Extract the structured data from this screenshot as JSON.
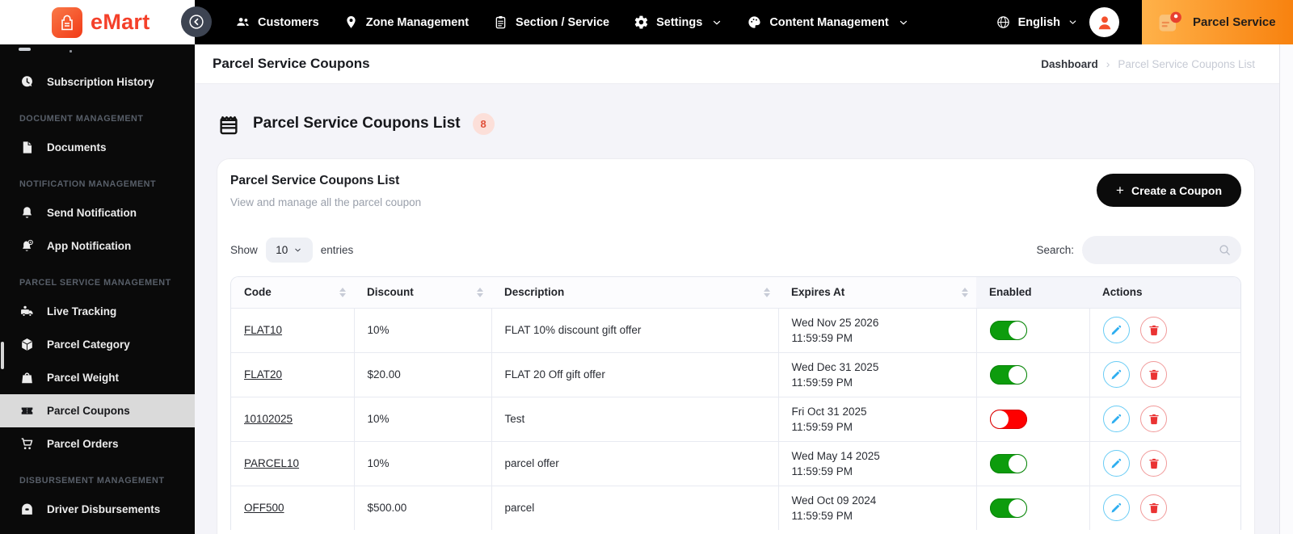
{
  "navbar": {
    "brand": "eMart",
    "menu": [
      {
        "label": "Customers",
        "icon": "customers-icon",
        "caret": false
      },
      {
        "label": "Zone Management",
        "icon": "zone-icon",
        "caret": false
      },
      {
        "label": "Section / Service",
        "icon": "section-service-icon",
        "caret": false
      },
      {
        "label": "Settings",
        "icon": "settings-icon",
        "caret": true
      },
      {
        "label": "Content Management",
        "icon": "content-management-icon",
        "caret": true
      }
    ],
    "language": "English",
    "service_tab": "Parcel Service"
  },
  "sidebar": {
    "sections": [
      {
        "header": "",
        "items": [
          {
            "label": "Subscription History",
            "icon": "subscription-history-icon",
            "active": false
          }
        ]
      },
      {
        "header": "DOCUMENT MANAGEMENT",
        "items": [
          {
            "label": "Documents",
            "icon": "documents-icon",
            "active": false
          }
        ]
      },
      {
        "header": "NOTIFICATION MANAGEMENT",
        "items": [
          {
            "label": "Send Notification",
            "icon": "send-notification-icon",
            "active": false
          },
          {
            "label": "App Notification",
            "icon": "app-notification-icon",
            "active": false
          }
        ]
      },
      {
        "header": "PARCEL SERVICE MANAGEMENT",
        "items": [
          {
            "label": "Live Tracking",
            "icon": "live-tracking-icon",
            "active": false
          },
          {
            "label": "Parcel Category",
            "icon": "parcel-category-icon",
            "active": false
          },
          {
            "label": "Parcel Weight",
            "icon": "parcel-weight-icon",
            "active": false
          },
          {
            "label": "Parcel Coupons",
            "icon": "parcel-coupons-icon",
            "active": true
          },
          {
            "label": "Parcel Orders",
            "icon": "parcel-orders-icon",
            "active": false
          }
        ]
      },
      {
        "header": "DISBURSEMENT MANAGEMENT",
        "items": [
          {
            "label": "Driver Disbursements",
            "icon": "driver-disbursements-icon",
            "active": false
          }
        ]
      }
    ]
  },
  "page": {
    "title": "Parcel Service Coupons",
    "breadcrumb": {
      "home": "Dashboard",
      "current": "Parcel Service Coupons List"
    },
    "list_title": "Parcel Service Coupons List",
    "count": "8"
  },
  "card": {
    "title": "Parcel Service Coupons List",
    "subtitle": "View and manage all the parcel coupon",
    "create_label": "Create a Coupon",
    "show_label": "Show",
    "page_size": "10",
    "entries_label": "entries",
    "search_label": "Search:",
    "search_value": ""
  },
  "table": {
    "columns": [
      {
        "label": "Code",
        "sortable": true,
        "shade": false
      },
      {
        "label": "Discount",
        "sortable": true,
        "shade": false
      },
      {
        "label": "Description",
        "sortable": true,
        "shade": false
      },
      {
        "label": "Expires At",
        "sortable": true,
        "shade": false
      },
      {
        "label": "Enabled",
        "sortable": false,
        "shade": true
      },
      {
        "label": "Actions",
        "sortable": false,
        "shade": true
      }
    ],
    "rows": [
      {
        "code": "FLAT10",
        "discount": "10%",
        "description": "FLAT 10% discount gift offer",
        "expires_date": "Wed Nov 25 2026",
        "expires_time": "11:59:59 PM",
        "enabled": true
      },
      {
        "code": "FLAT20",
        "discount": "$20.00",
        "description": "FLAT 20 Off gift offer",
        "expires_date": "Wed Dec 31 2025",
        "expires_time": "11:59:59 PM",
        "enabled": true
      },
      {
        "code": "10102025",
        "discount": "10%",
        "description": "Test",
        "expires_date": "Fri Oct 31 2025",
        "expires_time": "11:59:59 PM",
        "enabled": false
      },
      {
        "code": "PARCEL10",
        "discount": "10%",
        "description": "parcel offer",
        "expires_date": "Wed May 14 2025",
        "expires_time": "11:59:59 PM",
        "enabled": true
      },
      {
        "code": "OFF500",
        "discount": "$500.00",
        "description": "parcel",
        "expires_date": "Wed Oct 09 2024",
        "expires_time": "11:59:59 PM",
        "enabled": true
      }
    ]
  },
  "colors": {
    "brand_red": "#f4402a",
    "navbar_bg": "#000000",
    "tab_gradient_from": "#ffb24a",
    "tab_gradient_to": "#f8820f",
    "toggle_on_green": "#0d9c0d",
    "toggle_off_red": "#fe0000",
    "edit_blue": "#2eaef0",
    "delete_red": "#ea3333",
    "badge_bg": "#fcdfd9",
    "badge_text": "#e0503a"
  }
}
